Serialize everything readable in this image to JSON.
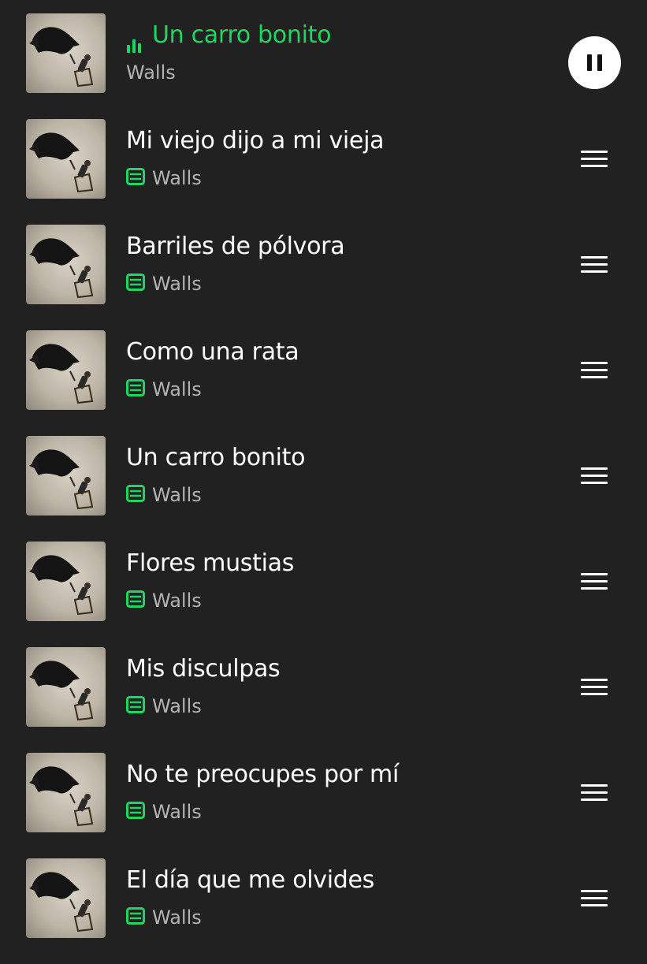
{
  "colors": {
    "background": "#212121",
    "accent": "#1ed760",
    "secondary_text": "#b3b3b3"
  },
  "now_playing": {
    "title": "Un carro bonito",
    "artist": "Walls",
    "indicator_icon": "equalizer-icon",
    "control_icon": "pause-icon"
  },
  "queue": [
    {
      "title": "Mi viejo dijo a mi vieja",
      "artist": "Walls",
      "badge_icon": "lyrics-badge-icon",
      "handle_icon": "drag-handle-icon"
    },
    {
      "title": "Barriles de pólvora",
      "artist": "Walls",
      "badge_icon": "lyrics-badge-icon",
      "handle_icon": "drag-handle-icon"
    },
    {
      "title": "Como una rata",
      "artist": "Walls",
      "badge_icon": "lyrics-badge-icon",
      "handle_icon": "drag-handle-icon"
    },
    {
      "title": "Un carro bonito",
      "artist": "Walls",
      "badge_icon": "lyrics-badge-icon",
      "handle_icon": "drag-handle-icon"
    },
    {
      "title": "Flores mustias",
      "artist": "Walls",
      "badge_icon": "lyrics-badge-icon",
      "handle_icon": "drag-handle-icon"
    },
    {
      "title": "Mis disculpas",
      "artist": "Walls",
      "badge_icon": "lyrics-badge-icon",
      "handle_icon": "drag-handle-icon"
    },
    {
      "title": "No te preocupes por mí",
      "artist": "Walls",
      "badge_icon": "lyrics-badge-icon",
      "handle_icon": "drag-handle-icon"
    },
    {
      "title": "El día que me olvides",
      "artist": "Walls",
      "badge_icon": "lyrics-badge-icon",
      "handle_icon": "drag-handle-icon"
    }
  ]
}
